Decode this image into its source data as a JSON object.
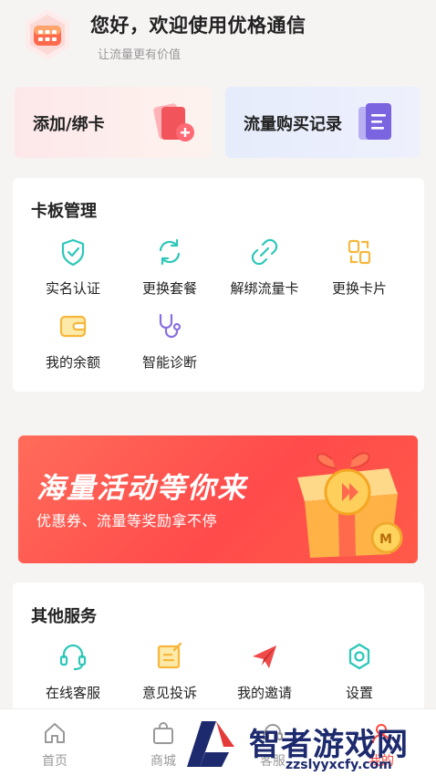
{
  "header": {
    "greeting": "您好，欢迎使用优格通信",
    "subtitle": "让流量更有价值",
    "logo_icon": "app-logo-icon"
  },
  "quick_actions": [
    {
      "label": "添加/绑卡",
      "icon": "add-card-icon"
    },
    {
      "label": "流量购买记录",
      "icon": "document-record-icon"
    }
  ],
  "card_management": {
    "title": "卡板管理",
    "items": [
      {
        "label": "实名认证",
        "icon": "shield-check-icon"
      },
      {
        "label": "更换套餐",
        "icon": "refresh-icon"
      },
      {
        "label": "解绑流量卡",
        "icon": "unlink-icon"
      },
      {
        "label": "更换卡片",
        "icon": "swap-card-icon"
      },
      {
        "label": "我的余额",
        "icon": "wallet-icon"
      },
      {
        "label": "智能诊断",
        "icon": "stethoscope-icon"
      }
    ]
  },
  "banner": {
    "title": "海量活动等你来",
    "subtitle": "优惠券、流量等奖励拿不停"
  },
  "other_services": {
    "title": "其他服务",
    "items": [
      {
        "label": "在线客服",
        "icon": "headset-icon"
      },
      {
        "label": "意见投诉",
        "icon": "edit-note-icon"
      },
      {
        "label": "我的邀请",
        "icon": "paper-plane-icon"
      },
      {
        "label": "设置",
        "icon": "gear-icon"
      }
    ]
  },
  "tabbar": {
    "items": [
      {
        "label": "首页",
        "icon": "home-icon"
      },
      {
        "label": "商城",
        "icon": "shopping-bag-icon"
      },
      {
        "label": "客服",
        "icon": "customer-service-icon"
      },
      {
        "label": "我的",
        "icon": "user-icon"
      }
    ]
  },
  "watermark": {
    "text": "智者游戏网",
    "url": "zzslyyxcfy.com"
  },
  "colors": {
    "teal": "#2cc7b8",
    "orange": "#f6b73c",
    "purple": "#8a6fe0",
    "red": "#f04a4a",
    "brand": "#ff6a4d"
  }
}
